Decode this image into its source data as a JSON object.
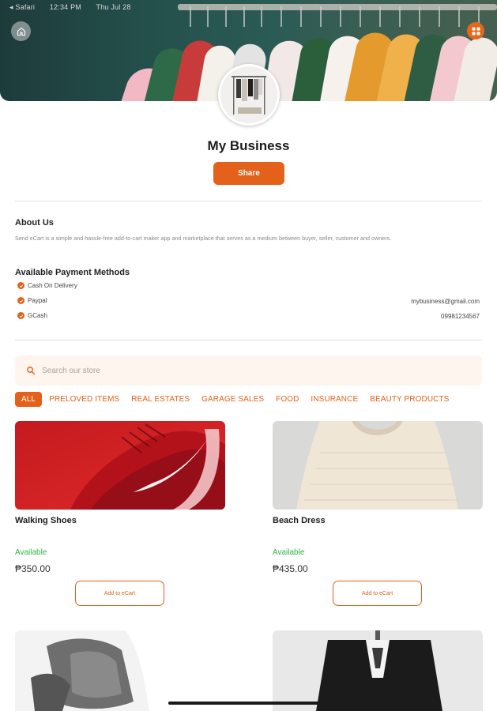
{
  "status_bar": {
    "carrier": "◂ Safari",
    "time": "12:34 PM",
    "date": "Thu Jul 28"
  },
  "header": {
    "home_icon": "home-icon",
    "menu_icon": "grid-icon"
  },
  "store": {
    "name": "My Business",
    "share_label": "Share"
  },
  "about": {
    "title": "About Us",
    "text": "Send eCart is a simple and hassle-free add-to-cart maker app and marketplace that serves as a medium between buyer, seller, customer and owners."
  },
  "payment": {
    "title": "Available Payment Methods",
    "methods": [
      "Cash On Delivery",
      "Paypal",
      "GCash"
    ],
    "email": "mybusiness@gmail.com",
    "phone": "09981234567"
  },
  "search": {
    "placeholder": "Search our store"
  },
  "categories": [
    "ALL",
    "PRELOVED ITEMS",
    "REAL ESTATES",
    "GARAGE SALES",
    "FOOD",
    "INSURANCE",
    "BEAUTY PRODUCTS"
  ],
  "products": [
    {
      "name": "Walking Shoes",
      "status": "Available",
      "price": "₱350.00",
      "button": "Add to eCart"
    },
    {
      "name": "Beach Dress",
      "status": "Available",
      "price": "₱435.00",
      "button": "Add to eCart"
    }
  ],
  "colors": {
    "accent": "#e3611a",
    "available": "#2fb344",
    "search_bg": "#fdf5ee"
  }
}
